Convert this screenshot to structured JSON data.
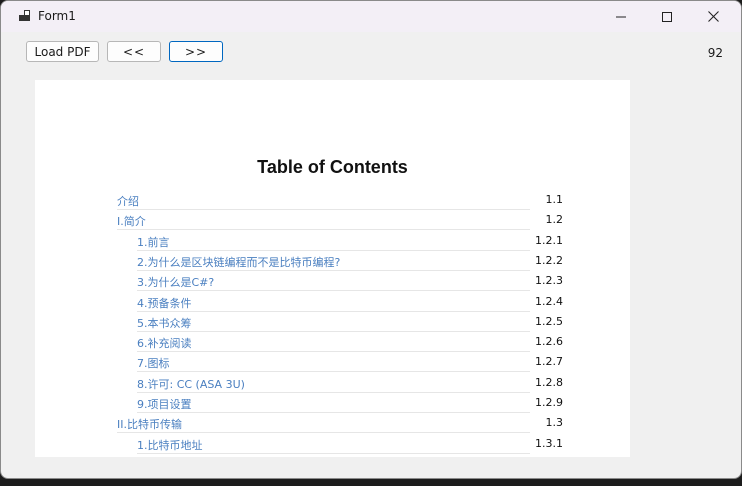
{
  "window": {
    "title": "Form1"
  },
  "toolbar": {
    "load_label": "Load PDF",
    "prev_label": "<<",
    "next_label": ">>",
    "page_count": "92"
  },
  "document": {
    "title": "Table of Contents",
    "entries": [
      {
        "label": "介绍",
        "number": "1.1",
        "level": 0
      },
      {
        "label": "I.简介",
        "number": "1.2",
        "level": 0
      },
      {
        "label": "1.前言",
        "number": "1.2.1",
        "level": 1
      },
      {
        "label": "2.为什么是区块链编程而不是比特币编程?",
        "number": "1.2.2",
        "level": 1
      },
      {
        "label": "3.为什么是C#?",
        "number": "1.2.3",
        "level": 1
      },
      {
        "label": "4.预备条件",
        "number": "1.2.4",
        "level": 1
      },
      {
        "label": "5.本书众筹",
        "number": "1.2.5",
        "level": 1
      },
      {
        "label": "6.补充阅读",
        "number": "1.2.6",
        "level": 1
      },
      {
        "label": "7.图标",
        "number": "1.2.7",
        "level": 1
      },
      {
        "label": "8.许可: CC (ASA 3U)",
        "number": "1.2.8",
        "level": 1
      },
      {
        "label": "9.项目设置",
        "number": "1.2.9",
        "level": 1
      },
      {
        "label": "II.比特币传输",
        "number": "1.3",
        "level": 0
      },
      {
        "label": "1.比特币地址",
        "number": "1.3.1",
        "level": 1
      }
    ]
  },
  "colors": {
    "link": "#4a7fc0",
    "accent": "#0067c0"
  }
}
